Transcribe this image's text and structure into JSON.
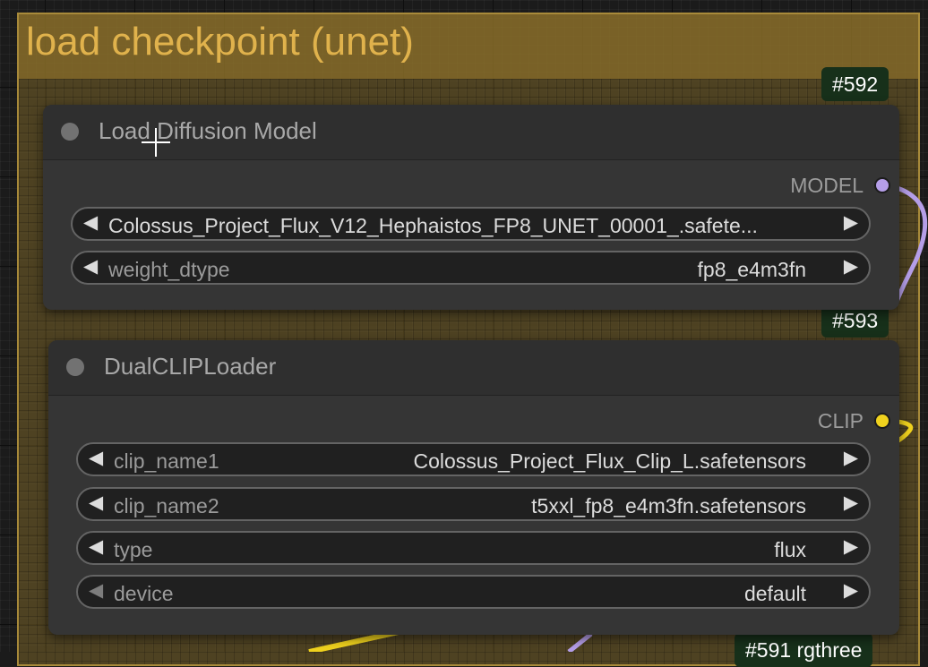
{
  "group": {
    "title": "load checkpoint (unet)"
  },
  "badges": {
    "b592": "#592",
    "b593": "#593",
    "b591": "#591 rgthree"
  },
  "nodes": {
    "load_diffusion_model": {
      "title": "Load Diffusion Model",
      "output": {
        "label": "MODEL",
        "color": "#b59ee8"
      },
      "widgets": {
        "unet_name": {
          "value": "Colossus_Project_Flux_V12_Hephaistos_FP8_UNET_00001_.safete..."
        },
        "weight_dtype": {
          "name": "weight_dtype",
          "value": "fp8_e4m3fn"
        }
      }
    },
    "dual_clip_loader": {
      "title": "DualCLIPLoader",
      "output": {
        "label": "CLIP",
        "color": "#f0d21e"
      },
      "widgets": {
        "clip_name1": {
          "name": "clip_name1",
          "value": "Colossus_Project_Flux_Clip_L.safetensors"
        },
        "clip_name2": {
          "name": "clip_name2",
          "value": "t5xxl_fp8_e4m3fn.safetensors"
        },
        "type": {
          "name": "type",
          "value": "flux"
        },
        "device": {
          "name": "device",
          "value": "default"
        }
      }
    }
  },
  "icons": {
    "arrow_left": "◀",
    "arrow_right": "▶",
    "cursor": "crosshair-cursor-icon"
  },
  "colors": {
    "group_title": "#e0b24c",
    "model_link": "#b59ee8",
    "clip_link": "#f0d21e",
    "badge_bg": "#17301a"
  }
}
